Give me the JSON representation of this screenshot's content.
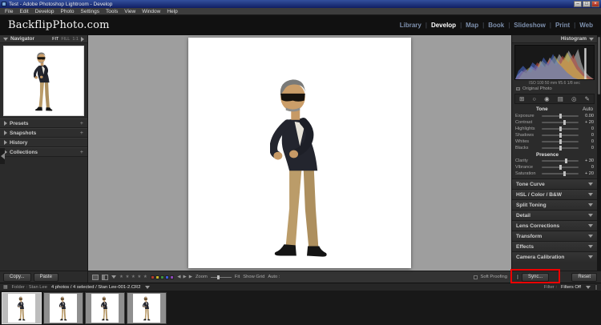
{
  "window": {
    "title": "Test - Adobe Photoshop Lightroom - Develop",
    "minimize": "–",
    "maximize": "□",
    "close": "×"
  },
  "menubar": {
    "items": [
      "File",
      "Edit",
      "Develop",
      "Photo",
      "Settings",
      "Tools",
      "View",
      "Window",
      "Help"
    ]
  },
  "header": {
    "logo": "BackflipPhoto.com",
    "separator": "|",
    "modules": [
      {
        "label": "Library"
      },
      {
        "label": "Develop"
      },
      {
        "label": "Map"
      },
      {
        "label": "Book"
      },
      {
        "label": "Slideshow"
      },
      {
        "label": "Print"
      },
      {
        "label": "Web"
      }
    ],
    "active_module": "Develop"
  },
  "left_panel": {
    "navigator_title": "Navigator",
    "zoom_modes": [
      "FIT",
      "FILL",
      "1:1"
    ],
    "sections": [
      "Presets",
      "Snapshots",
      "History",
      "Collections"
    ],
    "expand_glyph": "+",
    "copy_button": "Copy...",
    "paste_button": "Paste"
  },
  "right_panel": {
    "histogram_title": "Histogram",
    "histogram_meta": "ISO 100    50 mm    f/5.6    1/8 sec",
    "original_photo_label": "Original Photo",
    "tools": [
      {
        "name": "crop-overlay",
        "glyph": "⊞"
      },
      {
        "name": "spot-removal",
        "glyph": "○"
      },
      {
        "name": "red-eye",
        "glyph": "◉"
      },
      {
        "name": "graduated-filter",
        "glyph": "▤"
      },
      {
        "name": "radial-filter",
        "glyph": "◎"
      },
      {
        "name": "adjustment-brush",
        "glyph": "✎"
      }
    ],
    "tone_title": "Tone",
    "auto_button": "Auto",
    "tone_sliders": [
      {
        "label": "Exposure",
        "value": "0.00",
        "pos": 50
      },
      {
        "label": "Contrast",
        "value": "+ 20",
        "pos": 60
      },
      {
        "label": "Highlights",
        "value": "0",
        "pos": 50
      },
      {
        "label": "Shadows",
        "value": "0",
        "pos": 50
      },
      {
        "label": "Whites",
        "value": "0",
        "pos": 50
      },
      {
        "label": "Blacks",
        "value": "0",
        "pos": 50
      }
    ],
    "presence_title": "Presence",
    "presence_sliders": [
      {
        "label": "Clarity",
        "value": "+ 30",
        "pos": 65
      },
      {
        "label": "Vibrance",
        "value": "0",
        "pos": 50
      },
      {
        "label": "Saturation",
        "value": "+ 20",
        "pos": 60
      }
    ],
    "sections": [
      "Tone Curve",
      "HSL / Color / B&W",
      "Split Toning",
      "Detail",
      "Lens Corrections",
      "Transform",
      "Effects",
      "Camera Calibration"
    ],
    "sync_button": "Sync...",
    "reset_button": "Reset"
  },
  "toolbar": {
    "zoom_label": "Zoom",
    "fit_label": "Fit",
    "grid_label": "Show Grid",
    "auto_label": "Auto :",
    "soft_proofing_label": "Soft Proofing",
    "stars": "★ ★ ★ ★ ★",
    "swatches": [
      "#b03a2e",
      "#c9b428",
      "#3f8f3f",
      "#3b5bd8",
      "#8a46b4"
    ],
    "prev_glyph": "◀",
    "next_glyph": "▶",
    "play_glyph": "▶"
  },
  "filmstrip": {
    "grid_glyph": "▦",
    "folder_label": "Folder : Stan Lee",
    "selection_info": "4 photos / 4 selected / Stan Lee-001-2.CR2",
    "filter_label": "Filter :",
    "filter_value": "Filters Off"
  }
}
